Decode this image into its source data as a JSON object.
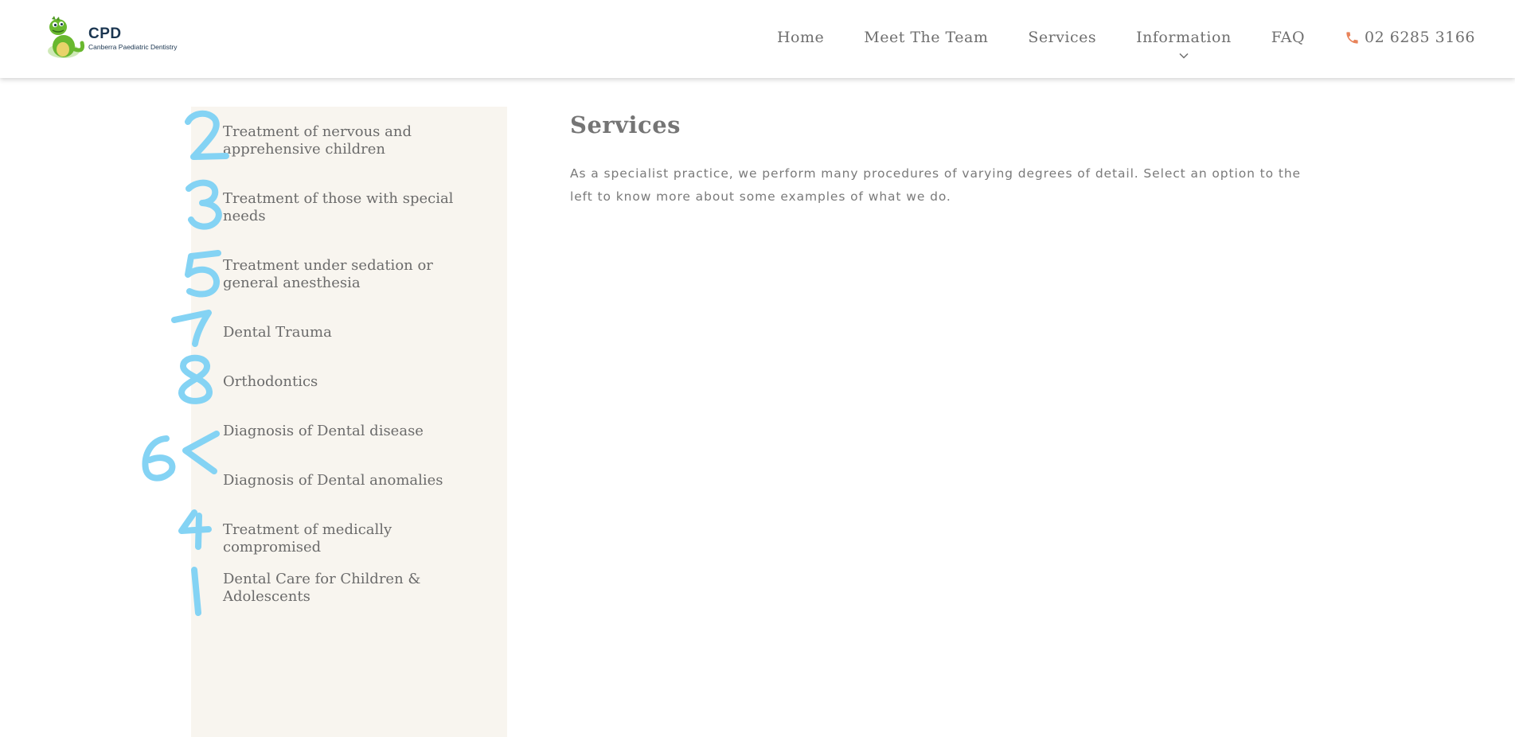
{
  "logo": {
    "abbr": "CPD",
    "name": "Canberra Paediatric Dentistry"
  },
  "nav": {
    "items": [
      "Home",
      "Meet The Team",
      "Services",
      "Information",
      "FAQ"
    ],
    "phone": "02 6285 3166"
  },
  "sidebar": {
    "items": [
      "Treatment of nervous and apprehensive children",
      "Treatment of those with special needs",
      "Treatment under sedation or general anesthesia",
      "Dental Trauma",
      "Orthodontics",
      "Diagnosis of Dental disease",
      "Diagnosis of Dental anomalies",
      "Treatment of medically compromised",
      "Dental Care for Children & Adolescents"
    ]
  },
  "main": {
    "title": "Services",
    "body": "As a specialist practice, we perform many procedures of varying degrees of detail. Select an option to the left to know more about some examples of what we do."
  },
  "annotations": {
    "color": "#84d3f4",
    "numbers": [
      "2",
      "3",
      "5",
      "7",
      "8",
      "6",
      "4",
      "1"
    ]
  },
  "colors": {
    "accent": "#e8835a",
    "sidebar_bg": "#f8f5ef"
  }
}
